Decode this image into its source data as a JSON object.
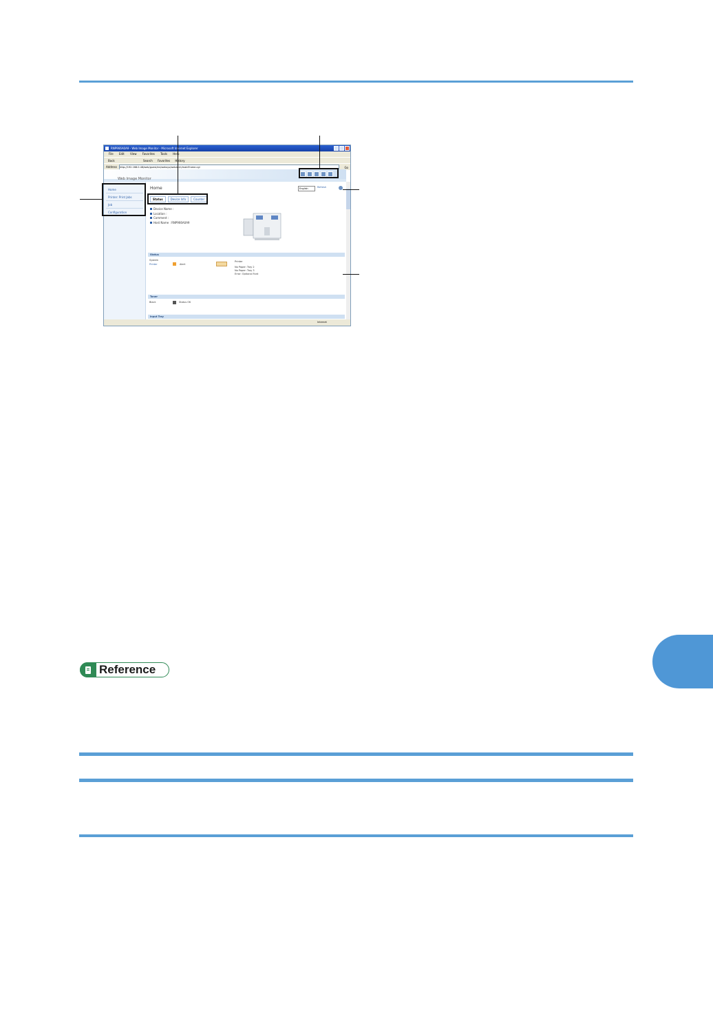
{
  "document": {
    "reference_label": "Reference"
  },
  "screenshot": {
    "window_title": "RNP966A0A9 - Web Image Monitor - Microsoft Internet Explorer",
    "menu": [
      "File",
      "Edit",
      "View",
      "Favorites",
      "Tools",
      "Help"
    ],
    "toolbar": [
      "Back",
      "Search",
      "Favorites",
      "History"
    ],
    "address_label": "Address",
    "address_value": "http://192.168.0.48/web/guest/en/websys/webArch/mainFrame.cgi",
    "go_label": "Go",
    "brand": "Web Image Monitor",
    "nav": [
      "Home",
      "Printer: Print Jobs",
      "Job",
      "Configuration"
    ],
    "page_title": "Home",
    "language": "English",
    "refresh": "Refresh",
    "tabs": [
      "Status",
      "Device Info",
      "Counter"
    ],
    "info": [
      {
        "label": "Device Name",
        "value": ":"
      },
      {
        "label": "Location",
        "value": ":"
      },
      {
        "label": "Comment",
        "value": ":"
      },
      {
        "label": "Host Name",
        "value": ": RNP966A0A9"
      }
    ],
    "status_header": "Status",
    "system_label": "System",
    "printer_label": "Printer",
    "alert_label": "Alert",
    "alert_panel": [
      "Printer",
      "No Paper: Tray 2",
      "No Paper: Tray 3",
      "Error: Optional Font"
    ],
    "toner_header": "Toner",
    "toner_black": "Black",
    "toner_status": "Status OK",
    "input_tray_header": "Input Tray",
    "status_bar_zone": "Internet"
  },
  "colors": {
    "rule": "#5a9fd6",
    "chapter_tab": "#4f97d6",
    "reference_green": "#2f8a55"
  }
}
